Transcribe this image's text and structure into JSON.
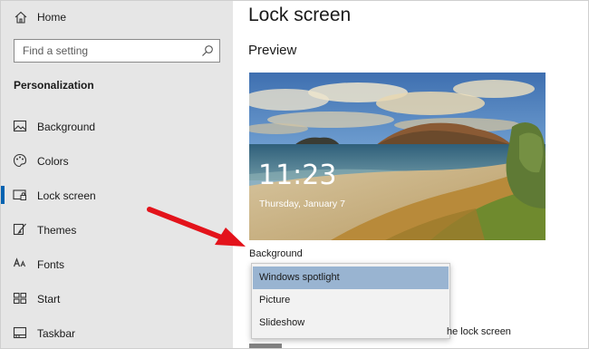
{
  "sidebar": {
    "home_label": "Home",
    "search_placeholder": "Find a setting",
    "section_title": "Personalization",
    "items": [
      {
        "label": "Background",
        "icon": "picture-icon"
      },
      {
        "label": "Colors",
        "icon": "palette-icon"
      },
      {
        "label": "Lock screen",
        "icon": "lock-screen-icon",
        "selected": true
      },
      {
        "label": "Themes",
        "icon": "themes-brush-icon"
      },
      {
        "label": "Fonts",
        "icon": "fonts-icon"
      },
      {
        "label": "Start",
        "icon": "start-grid-icon"
      },
      {
        "label": "Taskbar",
        "icon": "taskbar-icon"
      }
    ]
  },
  "main": {
    "title": "Lock screen",
    "preview_heading": "Preview",
    "preview": {
      "time": "11:23",
      "date": "Thursday, January 7"
    },
    "background_label": "Background",
    "dropdown": {
      "options": [
        "Windows spotlight",
        "Picture",
        "Slideshow"
      ],
      "selected_index": 0
    },
    "trailing_text": "he lock screen"
  },
  "colors": {
    "accent": "#0063b1",
    "selected_option": "#99b4d1",
    "sidebar_bg": "#e6e6e6",
    "arrow": "#e3131b"
  }
}
